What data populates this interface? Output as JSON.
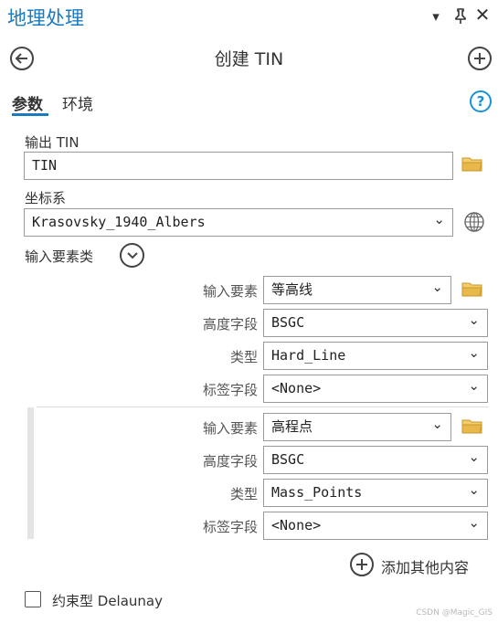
{
  "pane": {
    "title": "地理处理"
  },
  "tool": {
    "title": "创建 TIN"
  },
  "tabs": [
    {
      "label": "参数"
    },
    {
      "label": "环境"
    }
  ],
  "params": {
    "output_tin": {
      "label": "输出 TIN",
      "value": "TIN"
    },
    "coord_system": {
      "label": "坐标系",
      "value": "Krasovsky_1940_Albers"
    },
    "input_features_section": {
      "label": "输入要素类"
    }
  },
  "feature_labels": {
    "input_feature": "输入要素",
    "height_field": "高度字段",
    "type": "类型",
    "tag_field": "标签字段"
  },
  "feature_groups": [
    {
      "input_feature": "等高线",
      "height_field": "BSGC",
      "type": "Hard_Line",
      "tag_field": "<None>"
    },
    {
      "input_feature": "高程点",
      "height_field": "BSGC",
      "type": "Mass_Points",
      "tag_field": "<None>"
    }
  ],
  "add_more": {
    "label": "添加其他内容"
  },
  "constrained": {
    "label": "约束型 Delaunay",
    "checked": false
  },
  "watermark": "CSDN @Magic_GIS",
  "colors": {
    "accent": "#1a7bbf",
    "folder": "#e8b84a"
  },
  "icons": [
    "dropdown-icon",
    "pin-icon",
    "close-icon",
    "back-icon",
    "add-icon",
    "help-icon",
    "folder-icon",
    "globe-icon",
    "chevron-down-icon"
  ]
}
